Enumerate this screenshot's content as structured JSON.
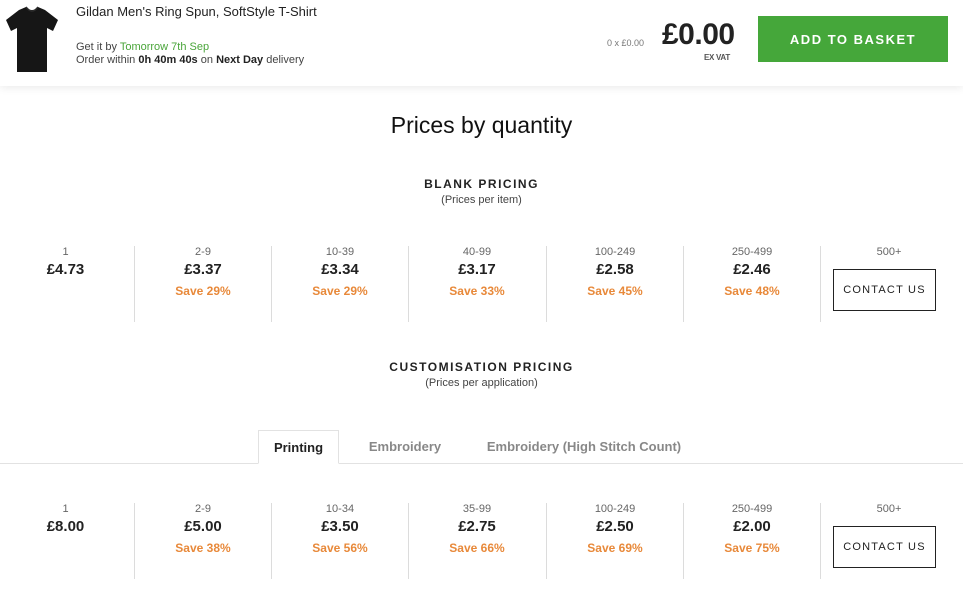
{
  "header": {
    "product_title": "Gildan Men's Ring Spun, SoftStyle T-Shirt",
    "delivery_prefix": "Get it by",
    "delivery_date": "Tomorrow 7th Sep",
    "order_within_prefix": "Order within",
    "countdown": "0h 40m 40s",
    "on_text": "on",
    "delivery_type": "Next Day",
    "delivery_suffix": "delivery",
    "qty_price": "0 x £0.00",
    "total": "£0.00",
    "vat_note": "EX VAT",
    "add_to_basket": "ADD TO BASKET"
  },
  "title": "Prices by quantity",
  "blank": {
    "heading": "BLANK PRICING",
    "subheading": "(Prices per item)",
    "tiers": [
      {
        "range": "1",
        "price": "£4.73",
        "save": ""
      },
      {
        "range": "2-9",
        "price": "£3.37",
        "save": "Save 29%"
      },
      {
        "range": "10-39",
        "price": "£3.34",
        "save": "Save 29%"
      },
      {
        "range": "40-99",
        "price": "£3.17",
        "save": "Save 33%"
      },
      {
        "range": "100-249",
        "price": "£2.58",
        "save": "Save 45%"
      },
      {
        "range": "250-499",
        "price": "£2.46",
        "save": "Save 48%"
      },
      {
        "range": "500+",
        "contact": "CONTACT US"
      }
    ]
  },
  "custom": {
    "heading": "CUSTOMISATION PRICING",
    "subheading": "(Prices per application)",
    "tabs": [
      {
        "label": "Printing",
        "active": true
      },
      {
        "label": "Embroidery",
        "active": false
      },
      {
        "label": "Embroidery (High Stitch Count)",
        "active": false
      }
    ],
    "tiers": [
      {
        "range": "1",
        "price": "£8.00",
        "save": ""
      },
      {
        "range": "2-9",
        "price": "£5.00",
        "save": "Save 38%"
      },
      {
        "range": "10-34",
        "price": "£3.50",
        "save": "Save 56%"
      },
      {
        "range": "35-99",
        "price": "£2.75",
        "save": "Save 66%"
      },
      {
        "range": "100-249",
        "price": "£2.50",
        "save": "Save 69%"
      },
      {
        "range": "250-499",
        "price": "£2.00",
        "save": "Save 75%"
      },
      {
        "range": "500+",
        "contact": "CONTACT US"
      }
    ]
  }
}
